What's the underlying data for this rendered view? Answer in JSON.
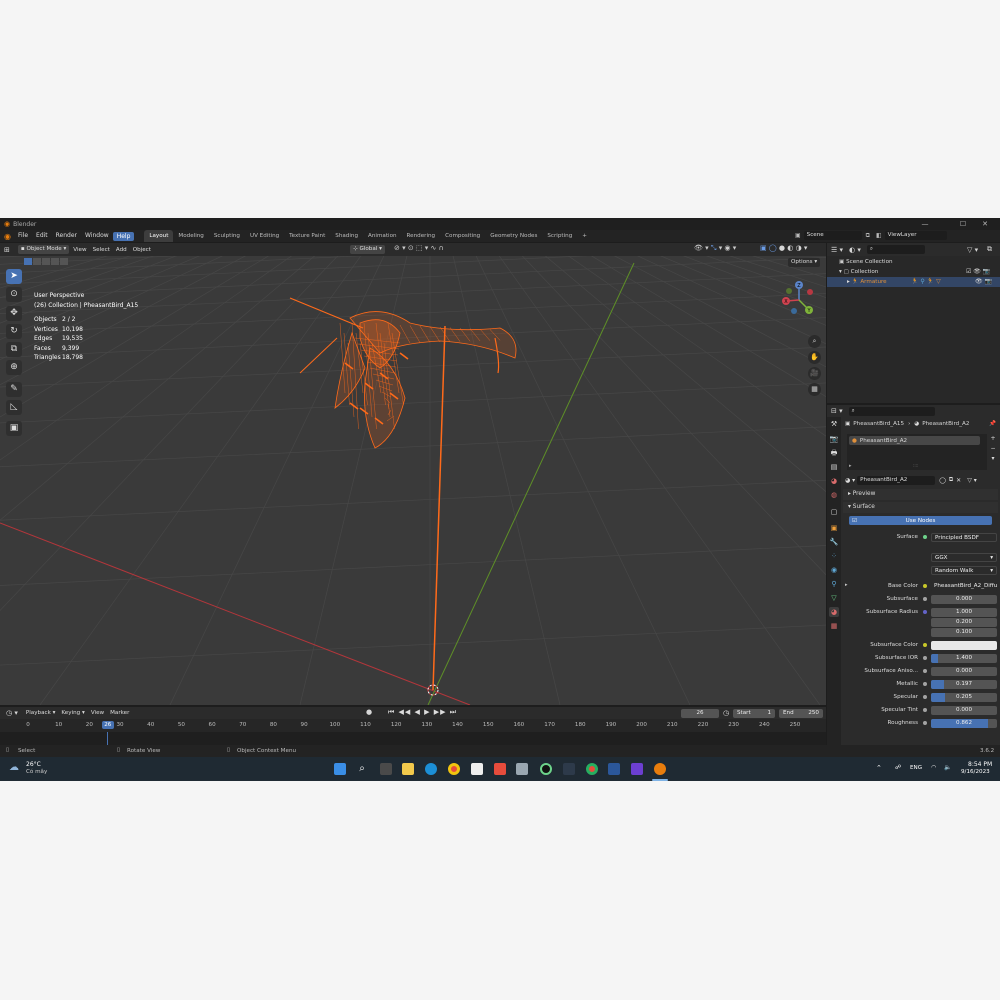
{
  "window": {
    "title": "Blender"
  },
  "menu": {
    "items": [
      "File",
      "Edit",
      "Render",
      "Window",
      "Help"
    ],
    "active": "Help"
  },
  "workspaces": {
    "tabs": [
      "Layout",
      "Modeling",
      "Sculpting",
      "UV Editing",
      "Texture Paint",
      "Shading",
      "Animation",
      "Rendering",
      "Compositing",
      "Geometry Nodes",
      "Scripting"
    ],
    "active": "Layout",
    "add": "+"
  },
  "scene": {
    "name": "Scene",
    "view_layer": "ViewLayer"
  },
  "viewport": {
    "mode": "Object Mode",
    "menus": [
      "View",
      "Select",
      "Add",
      "Object"
    ],
    "orientation": "Global",
    "options": "Options",
    "overlay_title": "User Perspective",
    "overlay_subtitle": "(26) Collection | PheasantBird_A15",
    "stats": [
      {
        "label": "Objects",
        "value": "2 / 2"
      },
      {
        "label": "Vertices",
        "value": "10,198"
      },
      {
        "label": "Edges",
        "value": "19,535"
      },
      {
        "label": "Faces",
        "value": "9,399"
      },
      {
        "label": "Triangles",
        "value": "18,798"
      }
    ],
    "gizmo": {
      "x": "X",
      "y": "Y",
      "z": "Z"
    },
    "colors": {
      "wire": "#ff6a1a",
      "x_axis": "#c2393d",
      "y_axis": "#6a9a2a",
      "grid": "#444444",
      "background": "#3a3a3a"
    }
  },
  "timeline": {
    "menus": [
      "Playback",
      "Keying",
      "View",
      "Marker"
    ],
    "current_frame": "26",
    "start_label": "Start",
    "start": "1",
    "end_label": "End",
    "end": "250",
    "ticks": [
      "0",
      "10",
      "20",
      "30",
      "40",
      "50",
      "60",
      "70",
      "80",
      "90",
      "100",
      "110",
      "120",
      "130",
      "140",
      "150",
      "160",
      "170",
      "180",
      "190",
      "200",
      "210",
      "220",
      "230",
      "240",
      "250"
    ]
  },
  "statusbar": {
    "select": "Select",
    "rotate": "Rotate View",
    "context": "Object Context Menu",
    "version": "3.6.2"
  },
  "outliner": {
    "search_placeholder": "",
    "rows": [
      {
        "label": "Scene Collection",
        "indent": 0
      },
      {
        "label": "Collection",
        "indent": 1
      },
      {
        "label": "Armature",
        "indent": 2
      }
    ]
  },
  "properties": {
    "breadcrumb_object": "PheasantBird_A15",
    "breadcrumb_material": "PheasantBird_A2",
    "slot": "PheasantBird_A2",
    "material": "PheasantBird_A2",
    "preview": "Preview",
    "surface_section": "Surface",
    "use_nodes": "Use Nodes",
    "surface_label": "Surface",
    "surface_shader": "Principled BSDF",
    "distribution": "GGX",
    "subsurface_method": "Random Walk",
    "fields": [
      {
        "label": "Base Color",
        "value": "PheasantBird_A2_Diffuse"
      },
      {
        "label": "Subsurface",
        "value": "0.000",
        "fill": 0
      },
      {
        "label": "Subsurface Radius",
        "value": "1.000",
        "fill": 0
      },
      {
        "label": "",
        "value": "0.200",
        "fill": 0
      },
      {
        "label": "",
        "value": "0.100",
        "fill": 0
      },
      {
        "label": "Subsurface Color",
        "value": "",
        "fill": 0
      },
      {
        "label": "Subsurface IOR",
        "value": "1.400",
        "fill": 0.1
      },
      {
        "label": "Subsurface Aniso...",
        "value": "0.000",
        "fill": 0
      },
      {
        "label": "Metallic",
        "value": "0.197",
        "fill": 0.197
      },
      {
        "label": "Specular",
        "value": "0.205",
        "fill": 0.205
      },
      {
        "label": "Specular Tint",
        "value": "0.000",
        "fill": 0
      },
      {
        "label": "Roughness",
        "value": "0.862",
        "fill": 0.862
      }
    ]
  },
  "taskbar": {
    "weather_temp": "26°C",
    "weather_desc": "Có mây",
    "lang": "ENG",
    "time": "8:54 PM",
    "date": "9/16/2023"
  }
}
